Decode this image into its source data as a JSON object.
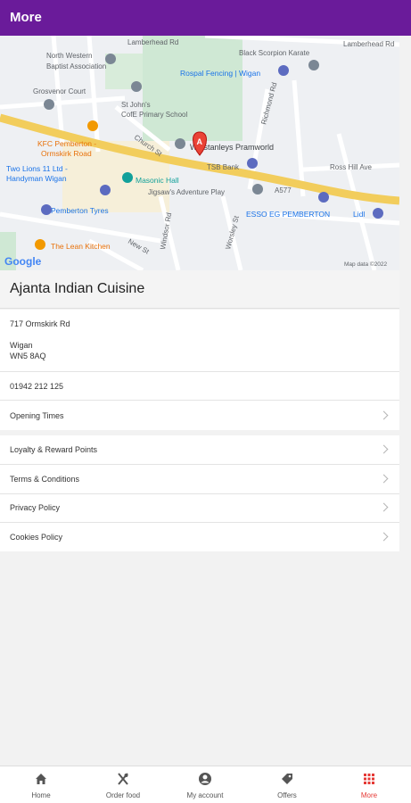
{
  "appbar": {
    "title": "More"
  },
  "map": {
    "labels": {
      "lamberhead_rd_1": "Lamberhead Rd",
      "lamberhead_rd_2": "Lamberhead Rd",
      "north_western": "North Western",
      "baptist": "Baptist Association",
      "black_scorpion": "Black Scorpion Karate",
      "rospal": "Rospal Fencing | Wigan",
      "grosvenor": "Grosvenor Court",
      "st_johns_1": "St John's",
      "st_johns_2": "CofE Primary School",
      "church_st": "Church St",
      "kfc_1": "KFC Pemberton -",
      "kfc_2": "Ormskirk Road",
      "winstanleys": "Winstanleys Pramworld",
      "tsb": "TSB Bank",
      "ross_hill": "Ross Hill Ave",
      "two_lions_1": "Two Lions 11 Ltd -",
      "two_lions_2": "Handyman Wigan",
      "masonic": "Masonic Hall",
      "jigsaws": "Jigsaw's Adventure Play",
      "a577": "A577",
      "esso": "ESSO EG PEMBERTON",
      "lidl": "Lidl",
      "pemberton_tyres": "Pemberton Tyres",
      "lean_kitchen": "The Lean Kitchen",
      "new_st": "New St",
      "richmond_rd": "Richmond Rd",
      "worsley_st": "Worsley St",
      "windsor_rd": "Windsor Rd",
      "marker": "A",
      "google": "Google",
      "map_data": "Map data ©2022"
    }
  },
  "restaurant": {
    "name": "Ajanta Indian Cuisine",
    "address_line1": "717 Ormskirk Rd",
    "city": "Wigan",
    "postcode": "WN5 8AQ",
    "phone": "01942 212 125"
  },
  "menu": {
    "opening_times": "Opening Times",
    "loyalty": "Loyalty & Reward Points",
    "terms": "Terms & Conditions",
    "privacy": "Privacy Policy",
    "cookies": "Cookies Policy"
  },
  "nav": {
    "home": "Home",
    "order_food": "Order food",
    "my_account": "My account",
    "offers": "Offers",
    "more": "More"
  },
  "colors": {
    "primary": "#6a1b9a",
    "accent": "#e53935"
  }
}
